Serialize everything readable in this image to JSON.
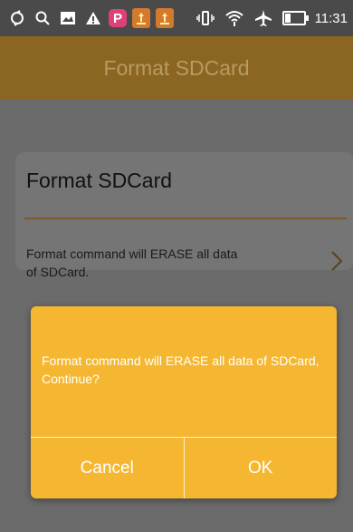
{
  "status_bar": {
    "left_icons": [
      "sync-icon",
      "search-icon",
      "image-icon",
      "warning-icon",
      "p-app-icon",
      "notification-badge-icon",
      "notification-badge-icon"
    ],
    "p_glyph": "P",
    "right_icons": [
      "vibrate-icon",
      "wifi-icon",
      "airplane-icon",
      "battery-icon"
    ],
    "battery_level": 0.3,
    "time": "11:31"
  },
  "title_bar": {
    "title": "Format SDCard"
  },
  "card": {
    "title": "Format SDCard",
    "description": "Format command will ERASE all data of SDCard."
  },
  "dialog": {
    "message": "Format command will ERASE all data of SDCard, Continue?",
    "cancel_label": "Cancel",
    "ok_label": "OK"
  },
  "colors": {
    "dialog_bg": "#f5b731",
    "title_bar_bg": "#8a6622",
    "overlay": "#6b6b6b"
  }
}
